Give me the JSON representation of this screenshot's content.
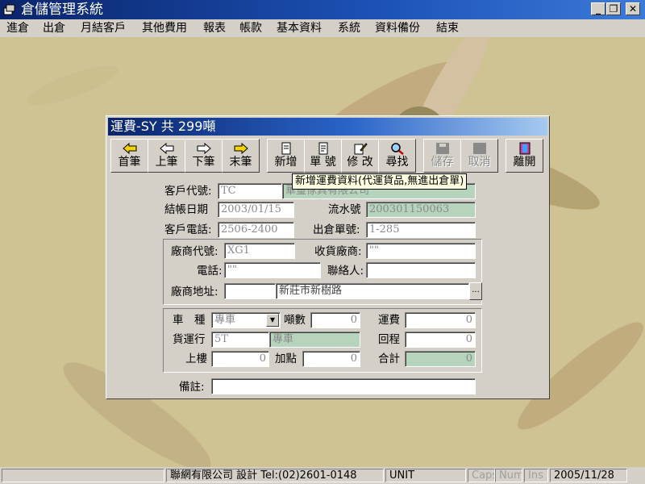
{
  "window": {
    "title": "倉儲管理系統"
  },
  "menu": [
    "進倉",
    "出倉",
    "月結客戶",
    "其他費用",
    "報表",
    "帳款",
    "基本資料",
    "系統",
    "資料備份",
    "結束"
  ],
  "dialog": {
    "title": "運費-SY 共 299噸",
    "toolbar": {
      "first": "首筆",
      "prev": "上筆",
      "next": "下筆",
      "last": "末筆",
      "add": "新增",
      "number": "單 號",
      "edit": "修 改",
      "find": "尋找",
      "save": "儲存",
      "cancel": "取消",
      "exit": "離開"
    },
    "tooltip": "新增運費資料(代運貨品,無進出倉單)",
    "labels": {
      "customer_code": "客戶代號:",
      "close_date": "結帳日期",
      "serial": "流水號",
      "customer_phone": "客戶電話:",
      "out_no": "出倉單號:",
      "vendor_code": "廠商代號:",
      "receiver": "收貨廠商:",
      "phone": "電話:",
      "contact": "聯絡人:",
      "vendor_addr": "廠商地址:",
      "vehicle": "車　種",
      "tons": "噸數",
      "freight": "運費",
      "carrier": "貨運行",
      "return": "回程",
      "upstairs": "上樓",
      "extra": "加點",
      "total": "合計",
      "remark": "備註:"
    },
    "values": {
      "customer_code": "TC",
      "customer_name": "華璽傢具有限公司",
      "close_date": "2003/01/15",
      "serial": "200301150063",
      "customer_phone": "2506-2400",
      "out_no": "1-285",
      "vendor_code": "XG1",
      "receiver": "\"\"",
      "phone": "\"\"",
      "contact": "",
      "vendor_zip": "",
      "vendor_addr": "新莊市新樹路",
      "vehicle": "專車",
      "tons": "0",
      "freight": "0",
      "carrier_code": "5T",
      "carrier_name": "專車",
      "return": "0",
      "upstairs": "0",
      "extra": "0",
      "total": "0",
      "remark": ""
    }
  },
  "status": {
    "company": "聯網有限公司 設計 Tel:(02)2601-0148",
    "unit": "UNIT",
    "caps": "Caps",
    "num": "Num",
    "ins": "Ins",
    "date": "2005/11/28"
  },
  "colors": {
    "title_bar": "#0a246a",
    "desktop": "#cfc393",
    "readonly_field": "#b5d4bb",
    "tooltip": "#ffffe1"
  }
}
